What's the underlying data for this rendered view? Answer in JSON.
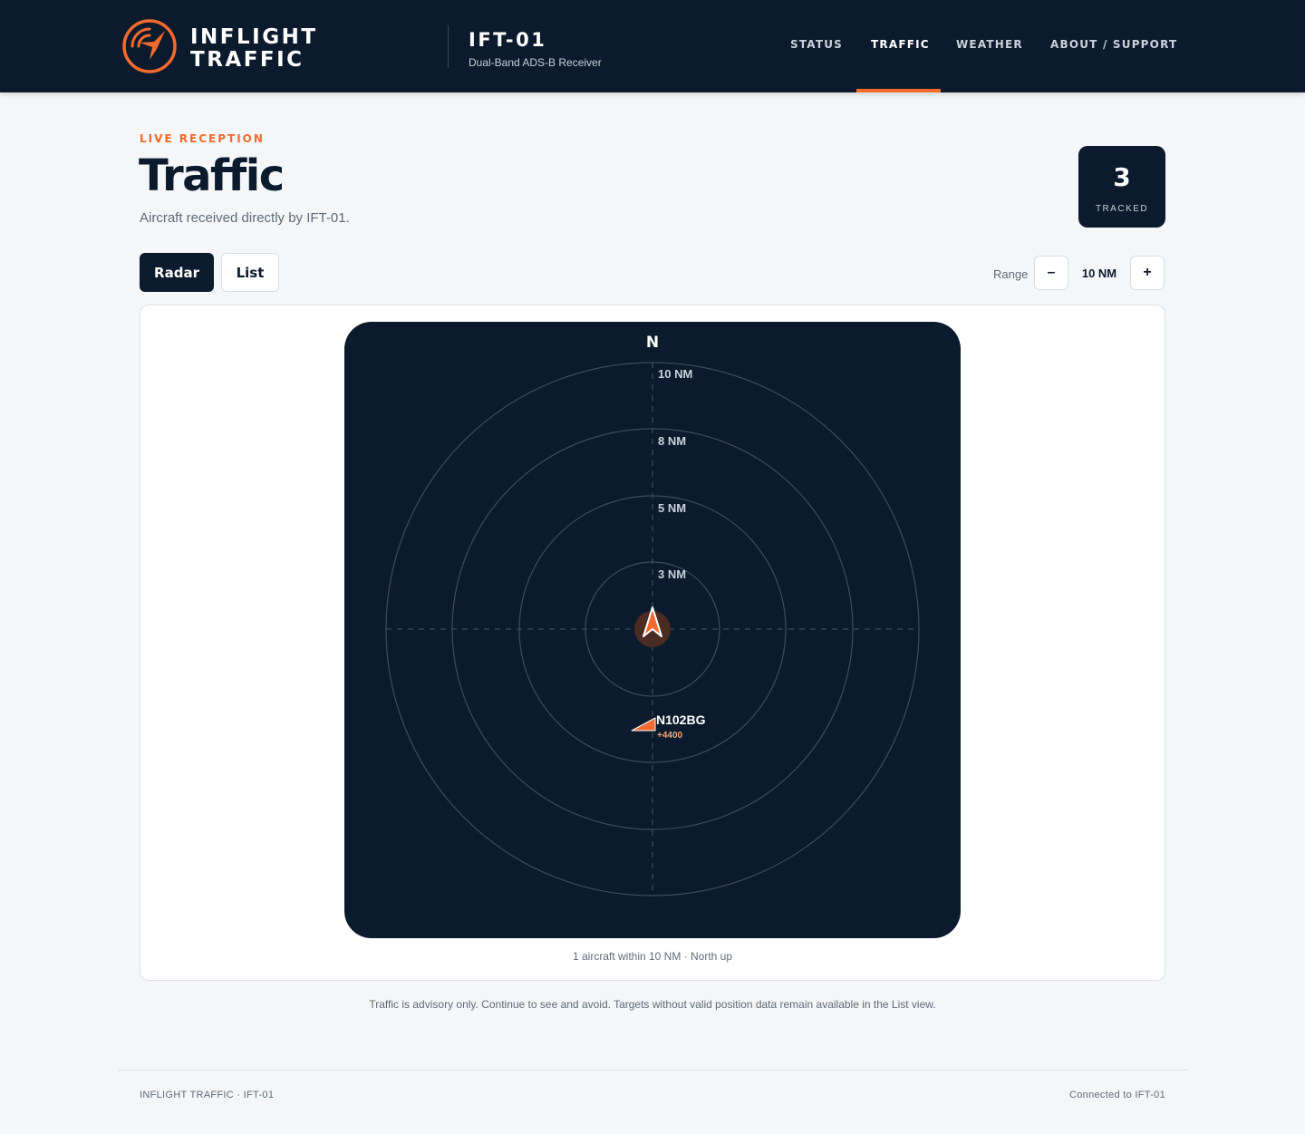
{
  "header": {
    "brand_line1": "INFLIGHT",
    "brand_line2": "TRAFFIC",
    "device_id": "IFT-01",
    "device_subtitle": "Dual-Band ADS-B Receiver",
    "nav": [
      {
        "label": "STATUS",
        "active": false
      },
      {
        "label": "TRAFFIC",
        "active": true
      },
      {
        "label": "WEATHER",
        "active": false
      },
      {
        "label": "ABOUT / SUPPORT",
        "active": false
      }
    ]
  },
  "page": {
    "eyebrow": "LIVE RECEPTION",
    "title": "Traffic",
    "subtitle": "Aircraft received directly by IFT-01.",
    "tracked_count": "3",
    "tracked_label": "TRACKED"
  },
  "controls": {
    "tabs": [
      {
        "label": "Radar",
        "active": true
      },
      {
        "label": "List",
        "active": false
      }
    ],
    "range_label": "Range",
    "range_minus": "–",
    "range_value": "10 NM",
    "range_plus": "+"
  },
  "radar": {
    "north_label": "N",
    "rings": [
      "10 NM",
      "8 NM",
      "5 NM",
      "3 NM"
    ],
    "targets": [
      {
        "callsign": "N102BG",
        "altitude": "+4400"
      }
    ],
    "caption": "1 aircraft within 10 NM · North up"
  },
  "advisory": "Traffic is advisory only. Continue to see and avoid. Targets without valid position data remain available in the List view.",
  "footer": {
    "left": "INFLIGHT TRAFFIC · IFT-01",
    "right": "Connected to IFT-01"
  },
  "colors": {
    "navy": "#0b1a2c",
    "accent": "#f26a2e",
    "background": "#f4f6f8"
  }
}
